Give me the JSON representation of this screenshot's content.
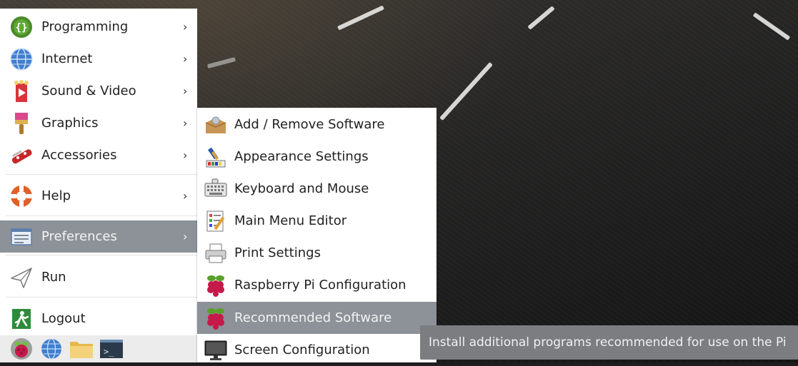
{
  "main_menu": {
    "items": [
      {
        "label": "Programming",
        "icon": "programming-icon"
      },
      {
        "label": "Internet",
        "icon": "internet-icon"
      },
      {
        "label": "Sound & Video",
        "icon": "sound-video-icon"
      },
      {
        "label": "Graphics",
        "icon": "graphics-icon"
      },
      {
        "label": "Accessories",
        "icon": "accessories-icon"
      },
      {
        "label": "Help",
        "icon": "help-icon"
      },
      {
        "label": "Preferences",
        "icon": "preferences-icon"
      },
      {
        "label": "Run",
        "icon": "run-icon"
      },
      {
        "label": "Logout",
        "icon": "logout-icon"
      }
    ],
    "arrow": "›"
  },
  "preferences_submenu": {
    "items": [
      {
        "label": "Add / Remove Software",
        "icon": "package-icon"
      },
      {
        "label": "Appearance Settings",
        "icon": "appearance-icon"
      },
      {
        "label": "Keyboard and Mouse",
        "icon": "keyboard-icon"
      },
      {
        "label": "Main Menu Editor",
        "icon": "menu-editor-icon"
      },
      {
        "label": "Print Settings",
        "icon": "printer-icon"
      },
      {
        "label": "Raspberry Pi Configuration",
        "icon": "raspberry-icon"
      },
      {
        "label": "Recommended Software",
        "icon": "raspberry-icon"
      },
      {
        "label": "Screen Configuration",
        "icon": "monitor-icon"
      }
    ]
  },
  "tooltip": {
    "text": "Install additional programs recommended for use on the Pi"
  },
  "taskbar": {
    "items": [
      "raspberry-menu-icon",
      "browser-icon",
      "file-manager-icon",
      "terminal-icon"
    ],
    "terminal_prompt": ">_"
  },
  "colors": {
    "selection": "#8c9298",
    "tooltip_bg": "#7b7d80"
  }
}
